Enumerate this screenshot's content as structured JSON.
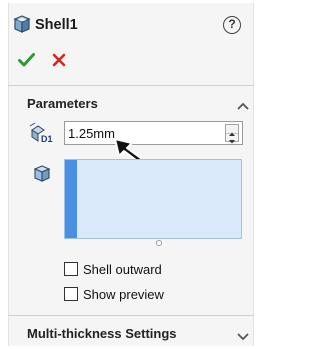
{
  "header": {
    "title": "Shell1",
    "help_icon": "question-mark-circle-icon",
    "help_glyph": "?",
    "ok_icon": "green-checkmark-icon",
    "cancel_icon": "red-x-icon"
  },
  "parameters": {
    "title": "Parameters",
    "thickness_icon": "thickness-d1-icon",
    "thickness_value": "1.25mm",
    "faces_icon": "cube-face-icon",
    "faces_to_remove": [],
    "shell_outward": {
      "label": "Shell outward",
      "checked": false
    },
    "show_preview": {
      "label": "Show preview",
      "checked": false
    }
  },
  "multi_thickness": {
    "title": "Multi-thickness Settings",
    "expanded": false
  },
  "colors": {
    "ok_green": "#2e9a2e",
    "cancel_red": "#d7261e",
    "selection_blue": "#4a90e2",
    "selection_fill": "#dbeafa"
  }
}
